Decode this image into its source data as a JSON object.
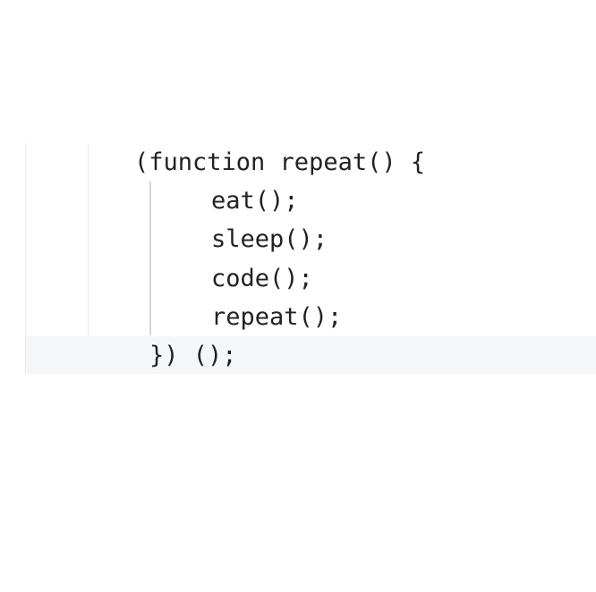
{
  "editor": {
    "lines": [
      "(function repeat() {",
      "eat();",
      "sleep();",
      "code();",
      "repeat();",
      "}) ();"
    ]
  }
}
